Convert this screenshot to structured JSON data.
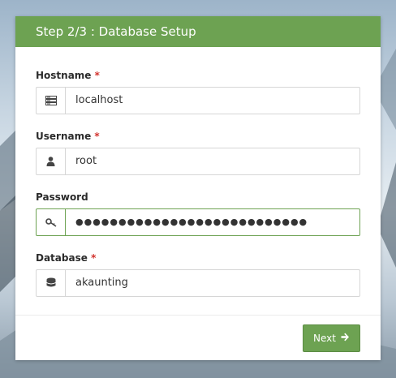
{
  "header": {
    "title": "Step 2/3 : Database Setup"
  },
  "fields": {
    "hostname": {
      "label": "Hostname",
      "required": "*",
      "value": "localhost",
      "icon": "server-icon"
    },
    "username": {
      "label": "Username",
      "required": "*",
      "value": "root",
      "icon": "user-icon"
    },
    "password": {
      "label": "Password",
      "value": "●●●●●●●●●●●●●●●●●●●●●●●●●●●",
      "icon": "key-icon"
    },
    "database": {
      "label": "Database",
      "required": "*",
      "value": "akaunting",
      "icon": "database-icon"
    }
  },
  "footer": {
    "next_label": "Next",
    "next_icon": "arrow-right-icon"
  },
  "colors": {
    "accent": "#6da252",
    "required": "#d2322d"
  }
}
